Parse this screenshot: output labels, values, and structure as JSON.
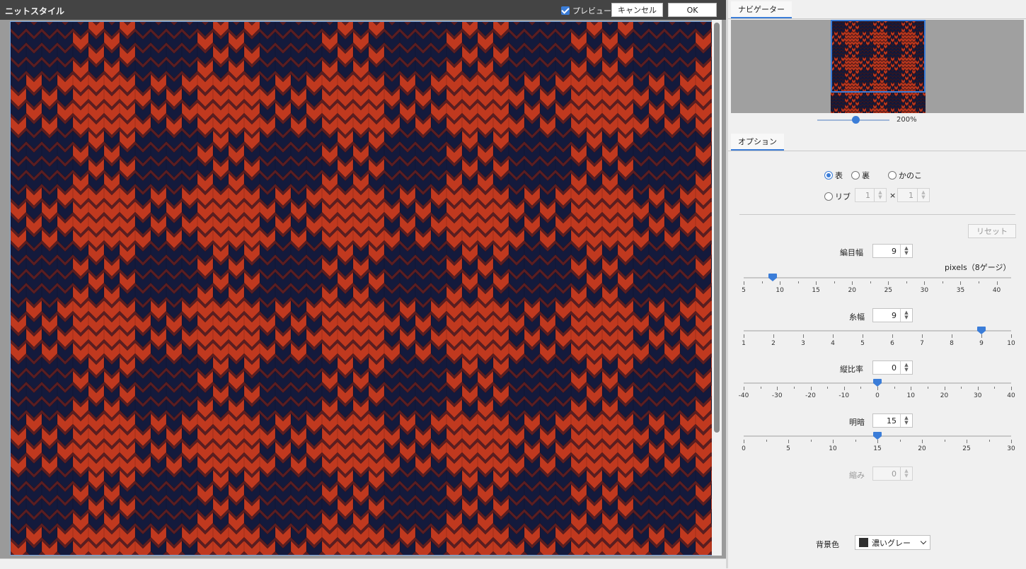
{
  "window": {
    "title": "ニットスタイル"
  },
  "toolbar": {
    "preview_label": "プレビュー",
    "preview_checked": true,
    "cancel_label": "キャンセル",
    "ok_label": "OK"
  },
  "colors": {
    "yarn_red": "#c0391f",
    "yarn_navy": "#141a3c",
    "accent": "#3b7dd8",
    "canvas_bg": "#9a9a9a"
  },
  "navigator": {
    "tab_label": "ナビゲーター",
    "zoom_text": "200%",
    "zoom_percent": 200
  },
  "options": {
    "tab_label": "オプション",
    "stitch_type": {
      "face": "表",
      "back": "裏",
      "kanoko": "かのこ",
      "rib": "リブ",
      "selected": "face"
    },
    "rib_a": "1",
    "rib_times": "×",
    "rib_b": "1",
    "reset_label": "リセット",
    "stitch_width": {
      "label": "編目幅",
      "value": "9",
      "unit_note": "pixels（8ゲージ）",
      "min": 5,
      "max": 42,
      "ticks": [
        "5",
        "10",
        "15",
        "20",
        "25",
        "30",
        "35",
        "40"
      ]
    },
    "yarn_width": {
      "label": "糸幅",
      "value": "9",
      "min": 1,
      "max": 10,
      "ticks": [
        "1",
        "2",
        "3",
        "4",
        "5",
        "6",
        "7",
        "8",
        "9",
        "10"
      ]
    },
    "aspect_ratio": {
      "label": "縦比率",
      "value": "0",
      "min": -40,
      "max": 40,
      "ticks": [
        "-40",
        "-30",
        "-20",
        "-10",
        "0",
        "10",
        "20",
        "30",
        "40"
      ]
    },
    "brightness": {
      "label": "明暗",
      "value": "15",
      "min": 0,
      "max": 30,
      "ticks": [
        "0",
        "5",
        "10",
        "15",
        "20",
        "25",
        "30"
      ]
    },
    "shrink": {
      "label": "縮み",
      "value": "0"
    },
    "background": {
      "label": "背景色",
      "value": "濃いグレー",
      "swatch": "#303030"
    }
  }
}
